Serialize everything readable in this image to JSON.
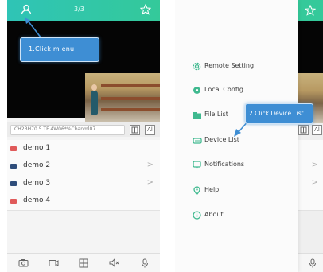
{
  "left_screen": {
    "header": {
      "page_indicator": "3/3"
    },
    "callout_text": "1.Click   m enu",
    "uid_text": "CH2BH70 5 TF 4W06*%Cbanml07",
    "devices": [
      {
        "name": "demo 1",
        "icon_color": "#e05a5a"
      },
      {
        "name": "demo 2",
        "icon_color": "#2f4d7a"
      },
      {
        "name": "demo 3",
        "icon_color": "#2f4d7a"
      },
      {
        "name": "demo 4",
        "icon_color": "#e05a5a"
      }
    ],
    "chevron": ">",
    "small_buttons": [
      "",
      "Al"
    ]
  },
  "right_screen": {
    "menu_items": [
      {
        "label": "Remote Setting",
        "icon": "gear-icon"
      },
      {
        "label": "Local Config",
        "icon": "settings-circle-icon"
      },
      {
        "label": "File List",
        "icon": "folder-icon"
      },
      {
        "label": "Device List",
        "icon": "device-icon"
      },
      {
        "label": "Notifications",
        "icon": "message-icon"
      },
      {
        "label": "Help",
        "icon": "location-pin-icon"
      },
      {
        "label": "About",
        "icon": "info-icon"
      }
    ],
    "callout_text": "2.Click Device List",
    "strip_button": "Al",
    "chevron": ">"
  },
  "colors": {
    "accent": "#34c99a",
    "callout": "#3e8ed4"
  }
}
